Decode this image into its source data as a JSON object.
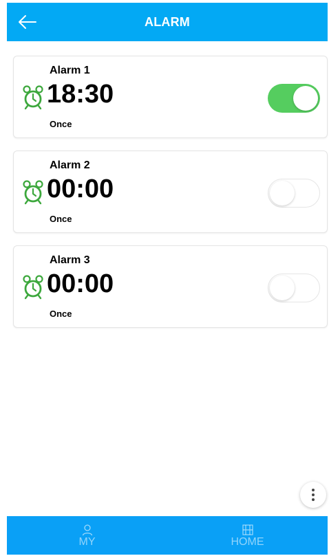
{
  "header": {
    "title": "ALARM",
    "back_icon": "arrow-left-icon",
    "background": "#03a9f4"
  },
  "alarms": [
    {
      "name": "Alarm 1",
      "time": "18:30",
      "repeat": "Once",
      "enabled": true
    },
    {
      "name": "Alarm 2",
      "time": "00:00",
      "repeat": "Once",
      "enabled": false
    },
    {
      "name": "Alarm 3",
      "time": "00:00",
      "repeat": "Once",
      "enabled": false
    }
  ],
  "colors": {
    "toggle_on": "#55cd5f",
    "clock_icon": "#3da83d",
    "nav_background": "#0aa0f6"
  },
  "fab": {
    "icon": "more-vertical-icon"
  },
  "bottom_nav": {
    "items": [
      {
        "label": "MY",
        "icon": "person-icon"
      },
      {
        "label": "HOME",
        "icon": "home-map-icon"
      }
    ]
  }
}
